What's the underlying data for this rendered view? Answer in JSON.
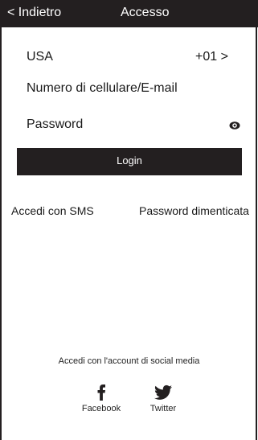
{
  "header": {
    "back_label": "< Indietro",
    "title": "Accesso"
  },
  "form": {
    "country": "USA",
    "country_code": "+01 >",
    "account_placeholder": "Numero di cellulare/E-mail",
    "password_placeholder": "Password",
    "login_label": "Login"
  },
  "links": {
    "sms_login": "Accedi con SMS",
    "forgot_password": "Password dimenticata"
  },
  "social": {
    "title": "Accedi con l'account di social media",
    "items": [
      {
        "label": "Facebook",
        "icon": "facebook-icon"
      },
      {
        "label": "Twitter",
        "icon": "twitter-icon"
      }
    ]
  },
  "colors": {
    "dark": "#231f20",
    "text": "#1a1a1a",
    "background": "#ffffff"
  }
}
